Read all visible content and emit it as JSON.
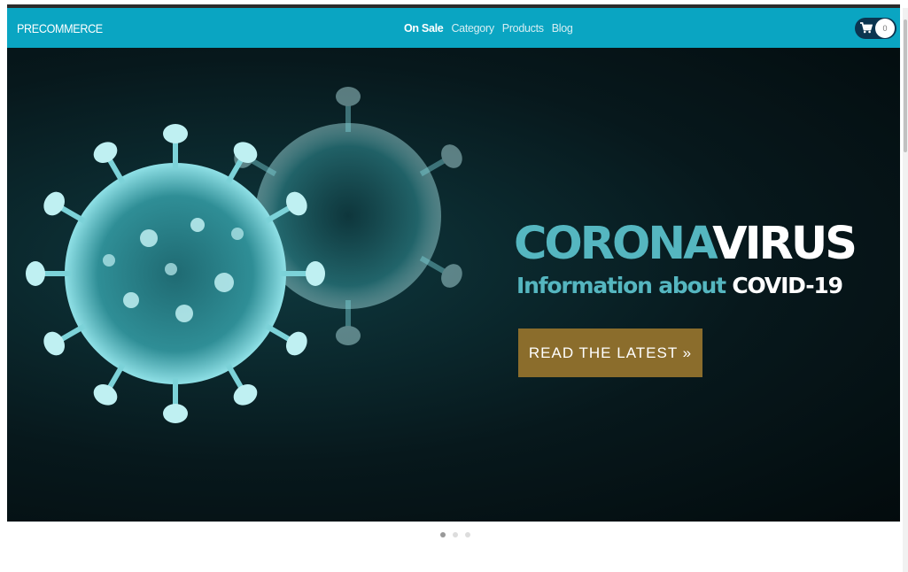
{
  "navbar": {
    "brand": "PRECOMMERCE",
    "links": [
      "On Sale",
      "Category",
      "Products",
      "Blog"
    ],
    "active_link": "On Sale",
    "cart_count": "0"
  },
  "hero": {
    "headline_part1": "CORONA",
    "headline_part2": "VIRUS",
    "subline_part1": "Information about",
    "subline_part2": "COVID-19",
    "cta_label": "READ THE LATEST »"
  },
  "carousel": {
    "slide_count": 3,
    "active_index": 0
  },
  "colors": {
    "navbar": "#0aa5c2",
    "accent_teal": "#55b6c0",
    "cta": "#8b6d2c",
    "cart_pill": "#0b3550"
  },
  "icons": [
    "cart-icon"
  ]
}
